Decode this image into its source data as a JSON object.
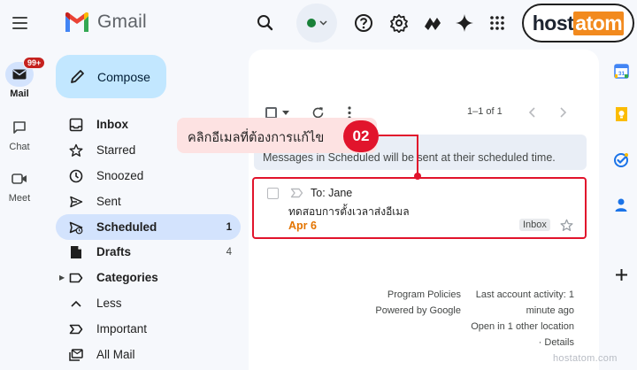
{
  "app": {
    "logo_text": "Gmail"
  },
  "brand": {
    "part1": "host",
    "part2": "atom"
  },
  "colors": {
    "accent": "#e1142c",
    "status": "#188038",
    "selected_bg": "#d3e3fd",
    "compose_bg": "#c2e7ff",
    "date": "#e37400"
  },
  "topbar": {
    "icons": [
      "menu-icon",
      "search-icon",
      "status-icon",
      "help-icon",
      "settings-icon",
      "gemini-apps-icon",
      "sparkle-icon",
      "apps-grid-icon"
    ]
  },
  "rail": {
    "items": [
      {
        "label": "Mail",
        "icon": "mail-icon",
        "badge": "99+"
      },
      {
        "label": "Chat",
        "icon": "chat-icon"
      },
      {
        "label": "Meet",
        "icon": "video-icon"
      }
    ]
  },
  "nav": {
    "compose_label": "Compose",
    "items": [
      {
        "label": "Inbox",
        "icon": "inbox-icon",
        "count": ""
      },
      {
        "label": "Starred",
        "icon": "star-icon",
        "count": ""
      },
      {
        "label": "Snoozed",
        "icon": "clock-icon",
        "count": ""
      },
      {
        "label": "Sent",
        "icon": "send-icon",
        "count": ""
      },
      {
        "label": "Scheduled",
        "icon": "scheduled-icon",
        "count": "1"
      },
      {
        "label": "Drafts",
        "icon": "draft-icon",
        "count": "4"
      },
      {
        "label": "Categories",
        "icon": "label-icon",
        "count": ""
      },
      {
        "label": "Less",
        "icon": "chevron-up-icon",
        "count": ""
      },
      {
        "label": "Important",
        "icon": "important-icon",
        "count": ""
      },
      {
        "label": "All Mail",
        "icon": "all-mail-icon",
        "count": ""
      }
    ]
  },
  "main": {
    "pagination": "1–1 of 1",
    "banner": "Messages in Scheduled will be sent at their scheduled time.",
    "email": {
      "to": "To: Jane",
      "subject": "ทดสอบการตั้งเวลาส่งอีเมล",
      "date": "Apr 6",
      "label": "Inbox"
    },
    "footer": {
      "links": [
        "Program Policies",
        "Powered by Google"
      ],
      "activity": [
        "Last account activity: 1",
        "minute ago",
        "Open in 1 other location",
        "· Details"
      ]
    }
  },
  "callout": {
    "text": "คลิกอีเมลที่ต้องการแก้ไข",
    "number": "02"
  },
  "side_panel": {
    "icons": [
      "calendar-icon",
      "keep-icon",
      "tasks-icon",
      "contacts-icon",
      "add-icon"
    ]
  },
  "watermark": "hostatom.com"
}
